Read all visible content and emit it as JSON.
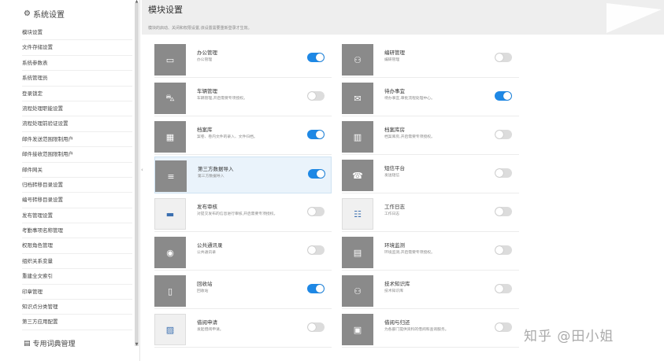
{
  "sidebar": {
    "header": "系统设置",
    "items": [
      "模块设置",
      "文件存储设置",
      "系统参数表",
      "系统管理员",
      "登录锁定",
      "流程处理职能设置",
      "流程处理前验证设置",
      "邮件发送范围限制用户",
      "邮件接收范围限制用户",
      "邮件网关",
      "归档转移目录设置",
      "编号转移目录设置",
      "发布管理设置",
      "考勤事项名称管理",
      "权限角色管理",
      "组织关系变量",
      "重建全文索引",
      "印章管理",
      "知识点分类管理",
      "第三方应用配置"
    ],
    "footer": "专用词典管理"
  },
  "header": {
    "title": "模块设置",
    "description": "模块的启动、关闭和权限设置,该设置需要重新登录才生效。"
  },
  "modules": [
    {
      "name": "办公管理",
      "desc": "办公管理",
      "on": true,
      "icon": "monitor-icon"
    },
    {
      "name": "编研管理",
      "desc": "编研管理",
      "on": false,
      "icon": "users-icon"
    },
    {
      "name": "车辆管理",
      "desc": "车辆管理,开启需要专项授权。",
      "on": false,
      "icon": "car-icon"
    },
    {
      "name": "待办事宜",
      "desc": "待办事宜,审批流程处理中心。",
      "on": true,
      "icon": "mail-icon"
    },
    {
      "name": "档案库",
      "desc": "案卷、卷内文件的录入、文件归档。",
      "on": true,
      "icon": "archive-icon"
    },
    {
      "name": "档案库房",
      "desc": "档案库房,开启需要专项授权。",
      "on": false,
      "icon": "building-icon"
    },
    {
      "name": "第三方数据导入",
      "desc": "第三方数据导入",
      "on": true,
      "icon": "database-icon",
      "highlighted": true
    },
    {
      "name": "短信平台",
      "desc": "发送短信",
      "on": false,
      "icon": "phone-icon"
    },
    {
      "name": "发布审核",
      "desc": "对提交发布的信息进行审核,开启需要专项授权。",
      "on": false,
      "icon": "publish-image-icon",
      "image": true
    },
    {
      "name": "工作日志",
      "desc": "工作日志",
      "on": false,
      "icon": "worklog-image-icon",
      "image": true
    },
    {
      "name": "公共通讯录",
      "desc": "公共通讯录",
      "on": false,
      "icon": "contact-icon"
    },
    {
      "name": "环境监测",
      "desc": "环境监测,开启需要专项授权。",
      "on": false,
      "icon": "monitor-chart-icon"
    },
    {
      "name": "回收站",
      "desc": "回收站",
      "on": true,
      "icon": "trash-icon"
    },
    {
      "name": "技术知识库",
      "desc": "技术知识库",
      "on": false,
      "icon": "knowledge-icon"
    },
    {
      "name": "借阅申请",
      "desc": "发起借阅申请。",
      "on": false,
      "icon": "borrow-image-icon",
      "image": true
    },
    {
      "name": "借阅与归还",
      "desc": "为各部门提供资料的借阅和查询服务。",
      "on": false,
      "icon": "return-icon"
    }
  ],
  "watermark": "知乎 @田小姐",
  "colors": {
    "toggle_on": "#1e88e5",
    "toggle_off": "#dcdcdc",
    "icon_bg": "#8a8a8a"
  }
}
